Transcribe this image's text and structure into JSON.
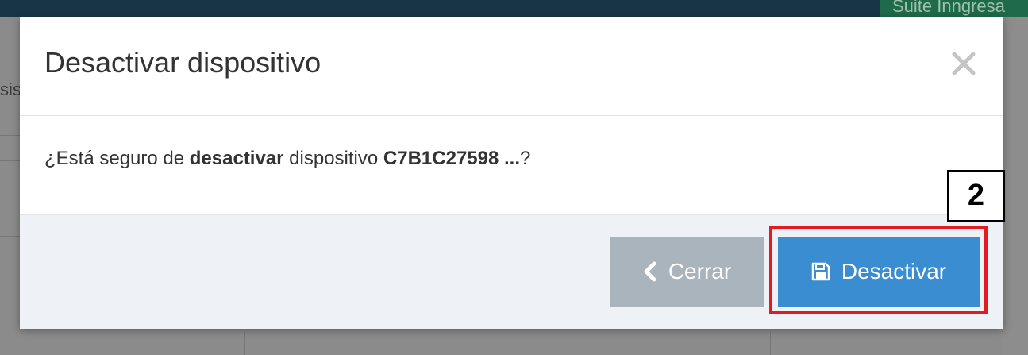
{
  "background": {
    "badge_text": "Suite Inngresa",
    "edge_text": "sis"
  },
  "modal": {
    "title": "Desactivar dispositivo",
    "close_symbol": "×",
    "message": {
      "prefix": "¿Está seguro de ",
      "action": "desactivar",
      "middle": " dispositivo ",
      "device_id": "C7B1C27598 ...",
      "suffix": "?"
    },
    "buttons": {
      "cancel_label": "Cerrar",
      "cancel_icon": "chevron-left-icon",
      "confirm_label": "Desactivar",
      "confirm_icon": "floppy-disk-icon"
    }
  },
  "annotation": {
    "step_number": "2",
    "highlight_color": "#e11b22"
  },
  "colors": {
    "primary": "#3b8dd1",
    "cancel": "#a9b4bc",
    "footer_bg": "#eef1f5"
  }
}
